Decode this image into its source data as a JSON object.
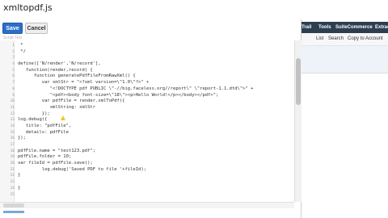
{
  "editor": {
    "file_name": "xmltopdf.js",
    "save_label": "Save",
    "cancel_label": "Cancel",
    "sub_label": "Script Text",
    "lines": [
      {
        "n": "1",
        "text": " *"
      },
      {
        "n": "2",
        "text": " */"
      },
      {
        "n": "3",
        "text": ""
      },
      {
        "n": "4",
        "text": "define(['N/render','N/record'],"
      },
      {
        "n": "5",
        "text": "   function(render,record) {"
      },
      {
        "n": "6",
        "text": "      function generatePdfFileFromRawXml() {"
      },
      {
        "n": "7",
        "text": "         var xmlStr = \"<?xml version=\\\"1.0\\\"?>\" +"
      },
      {
        "n": "8",
        "text": "            \"<!DOCTYPE pdf PUBLIC \\\"-//big.faceless.org//report\\\" \\\"report-1.1.dtd\\\">\" +"
      },
      {
        "n": "9",
        "text": "            \"<pdf><body font-size=\\\"18\\\"><p>Hello World!</p></body></pdf>\";"
      },
      {
        "n": "10",
        "text": "         var pdfFile = render.xmlToPdf({"
      },
      {
        "n": "11",
        "text": "            xmlString: xmlStr"
      },
      {
        "n": "12",
        "text": "         });"
      },
      {
        "n": "13",
        "text": "log.debug({"
      },
      {
        "n": "14",
        "text": "   title: \"pdfFile\","
      },
      {
        "n": "15",
        "text": "   details: pdfFile"
      },
      {
        "n": "16",
        "text": "});"
      },
      {
        "n": "17",
        "text": ""
      },
      {
        "n": "18",
        "text": "pdfFile.name = \"test123.pdf\";"
      },
      {
        "n": "19",
        "text": "pdfFile.folder = 10;"
      },
      {
        "n": "20",
        "text": "var fileId = pdfFile.save();"
      },
      {
        "n": "21",
        "text": "         log.debug('Saved PDF to file '+fileId);"
      },
      {
        "n": "22",
        "text": "}"
      },
      {
        "n": "23",
        "text": ""
      },
      {
        "n": "24",
        "text": "}"
      },
      {
        "n": "25",
        "text": ""
      }
    ]
  },
  "background_app": {
    "nav": [
      "Trail",
      "Tools",
      "SuiteCommerce",
      "Extract"
    ],
    "bar": [
      "List",
      "Search",
      "Copy to Account"
    ]
  }
}
